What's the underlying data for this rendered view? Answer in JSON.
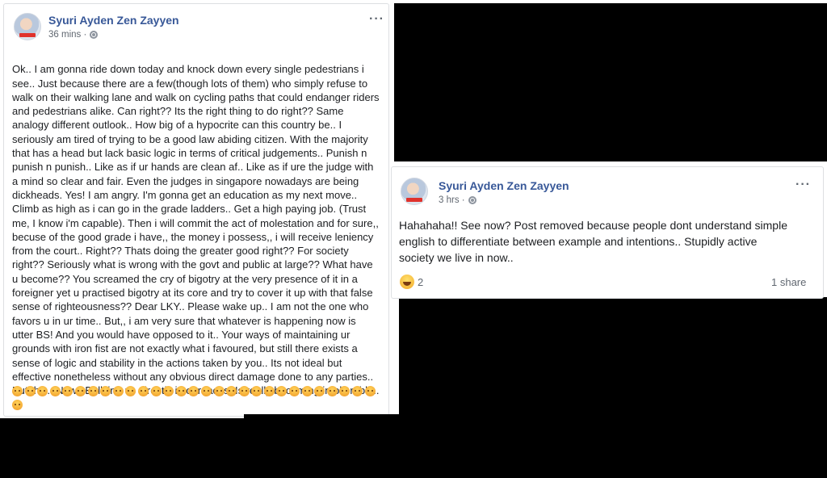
{
  "post1": {
    "author": "Syuri Ayden Zen Zayyen",
    "time": "36 mins ·",
    "more": "···",
    "lines": [
      "Ok.. I am gonna ride down today and knock down every single pedestrians i",
      "see.. Just because there are a few(though lots of them) who simply refuse to",
      "walk on their walking lane and walk on cycling paths that could endanger riders",
      "and pedestrians alike. Can right?? Its the right thing to do right?? Same",
      "analogy different outlook.. How big of a hypocrite can this country be.. I",
      "seriously am tired of trying to be a good law abiding citizen. With the majority",
      "that has a head but lack basic logic in terms of critical judgements.. Punish n",
      "punish n punish.. Like as if ur hands are clean af.. Like as if ure the judge with",
      "a mind so clear and fair. Even the judges in singapore nowadays are being",
      "dickheads. Yes! I am angry. I'm gonna get an education as my next move..",
      "Climb as high as i can go in the grade ladders.. Get a high paying job. (Trust",
      "me, I know i'm capable). Then i will commit the act of molestation and for sure,,",
      "becuse of the good grade i have,, the money i possess,, i will receive leniency",
      "from the court.. Right?? Thats doing the greater good right?? For society",
      "right?? Seriously what is wrong with the govt and public at large?? What have",
      "u become?? You screamed the cry of bigotry at the very presence of it in a",
      "foreigner yet u practised bigotry at its core and try to cover it up with that false",
      "sense of righteousness?? Dear LKY.. Please wake up.. I am not the one who",
      "favors u in ur time.. But,, i am very sure that whatever is happening now is",
      "utter BS! And you would have opposed to it.. Your ways of maintaining ur",
      "grounds with iron fist are not exactly what i favoured, but still there exists a",
      "sense of logic and stability in the actions taken by you.. Its not ideal but",
      "effective nonetheless without any obvious direct damage done to any parties..",
      "But this.. Now.. Bullying us directly in our faces. Is really becoming intollerable.."
    ],
    "emoji_count": 30,
    "emoji_name": "angry-emoji"
  },
  "post2": {
    "author": "Syuri Ayden Zen Zayyen",
    "time": "3 hrs ·",
    "more": "···",
    "text": "Hahahaha!! See now? Post removed because people dont understand simple\nenglish to differentiate between example and intentions.. Stupidly active\nsociety we live in now..",
    "reaction_count": "2",
    "shares": "1 share"
  },
  "colors": {
    "name": "#385898",
    "meta": "#606770",
    "text": "#1c1e21",
    "redaction": "#000000"
  }
}
